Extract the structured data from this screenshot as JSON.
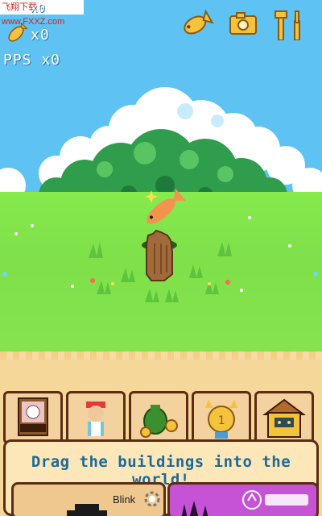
{
  "watermark": "飞翔下载 www.FXXZ.com",
  "hud": {
    "top_count": "x0",
    "fish_count": "x0",
    "pps": "PPS x0"
  },
  "panel": {
    "tip": "Drag the buildings into the world!",
    "blink_label": "Blink"
  },
  "tray": {
    "items": [
      "cat-sign",
      "farmer",
      "money-bag",
      "cat-medal",
      "cat-house"
    ]
  },
  "colors": {
    "sky": "#5ec2f2",
    "grass": "#7fe04a",
    "dirt": "#f6d79a",
    "text_accent": "#1c6a9b",
    "purple_card": "#c653d6"
  }
}
